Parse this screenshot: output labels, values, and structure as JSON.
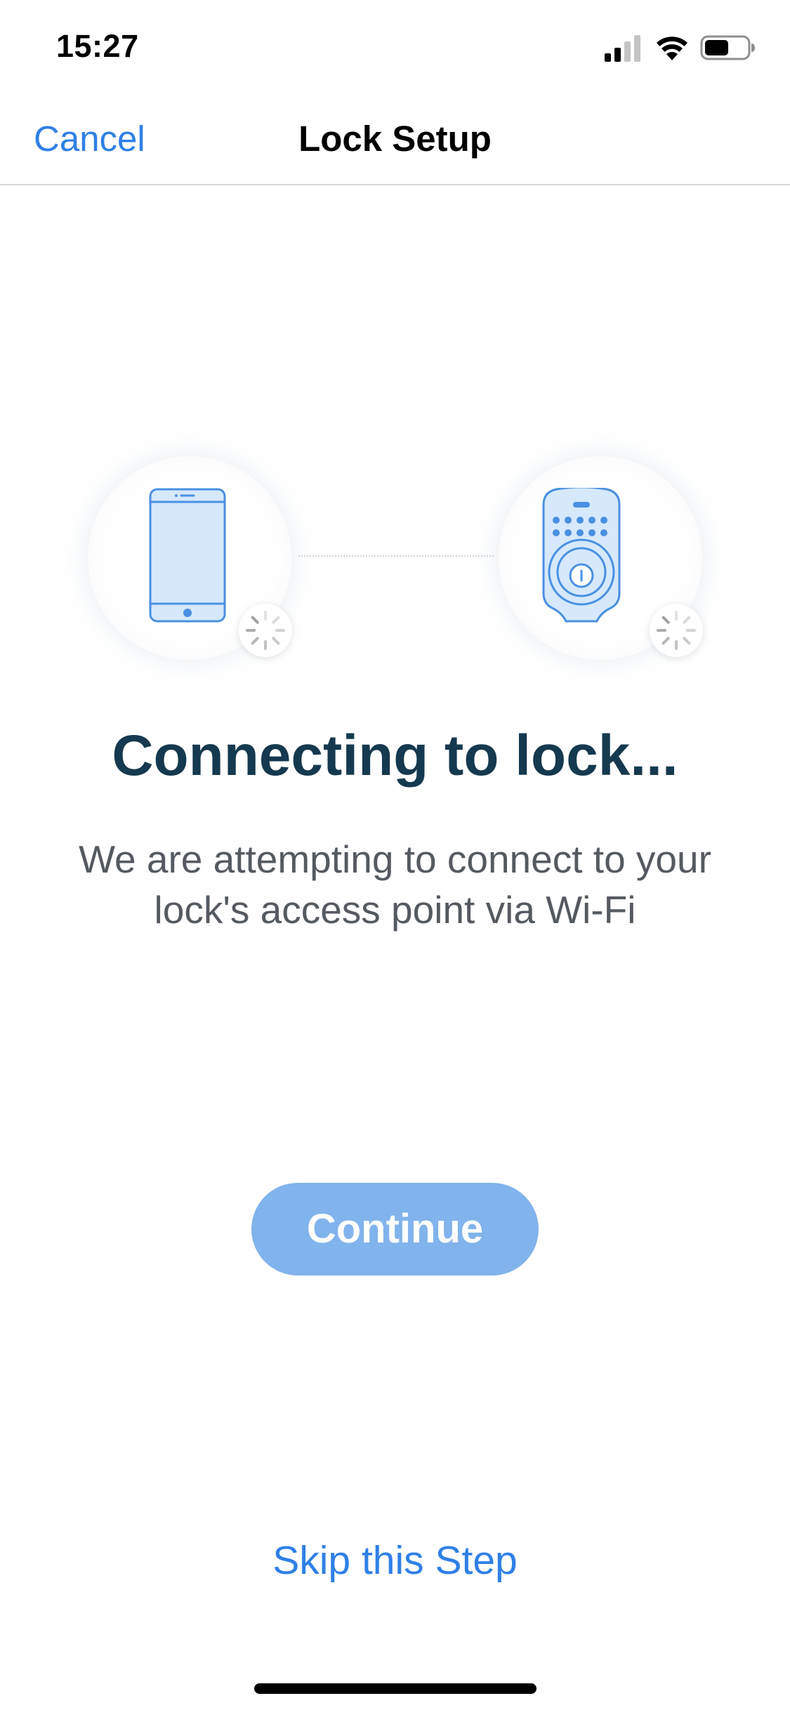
{
  "status_bar": {
    "time": "15:27",
    "icons": [
      "cellular-signal-icon",
      "wifi-icon",
      "battery-icon"
    ]
  },
  "nav": {
    "cancel_label": "Cancel",
    "title": "Lock Setup"
  },
  "illustration": {
    "left_device": "phone-icon",
    "right_device": "smart-lock-icon",
    "status": "loading"
  },
  "content": {
    "heading": "Connecting to lock...",
    "description": "We are attempting to connect to your lock's access point via Wi-Fi"
  },
  "actions": {
    "continue_label": "Continue",
    "continue_enabled": false,
    "skip_label": "Skip this Step"
  },
  "colors": {
    "accent": "#2f80e6",
    "button_disabled": "#81b3ec",
    "heading": "#15394f",
    "body_text": "#555a61",
    "device_fill": "#d6e8fc",
    "device_stroke": "#4a90e2"
  }
}
